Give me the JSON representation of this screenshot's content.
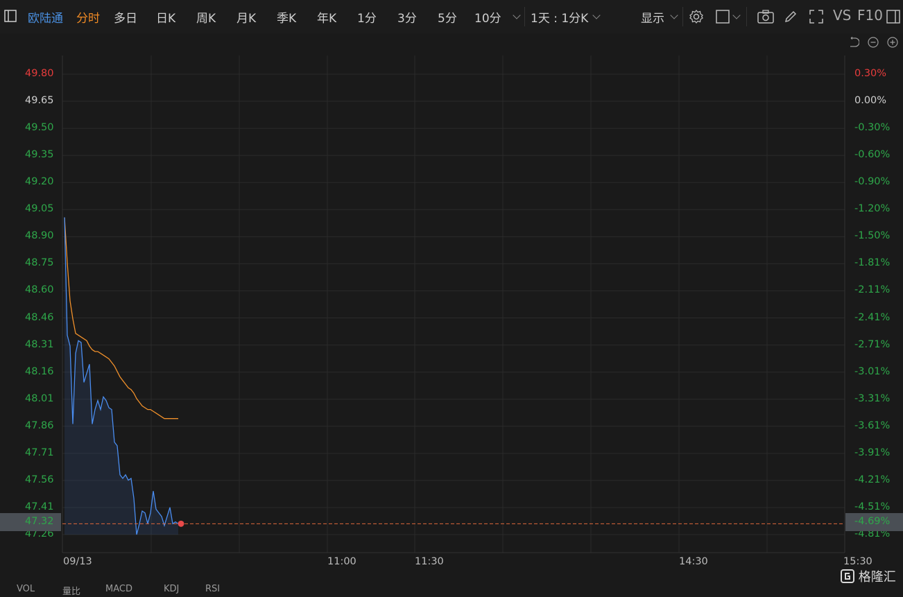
{
  "toolbar": {
    "stock_name": "欧陆通",
    "tabs": [
      "分时",
      "多日",
      "日K",
      "周K",
      "月K",
      "季K",
      "年K",
      "1分",
      "3分",
      "5分",
      "10分"
    ],
    "active_tab": "分时",
    "interval_select": "1天 : 1分K",
    "display_label": "显示",
    "vs_label": "VS",
    "f10_label": "F10"
  },
  "chart_data": {
    "type": "line",
    "date_label": "09/13",
    "time_ticks": [
      "11:00",
      "11:30",
      "14:30",
      "15:30"
    ],
    "price_ticks": [
      "49.80",
      "49.65",
      "49.50",
      "49.35",
      "49.20",
      "49.05",
      "48.90",
      "48.75",
      "48.60",
      "48.46",
      "48.31",
      "48.16",
      "48.01",
      "47.86",
      "47.71",
      "47.56",
      "47.41",
      "47.26"
    ],
    "pct_ticks": [
      "0.30%",
      "0.00%",
      "-0.30%",
      "-0.60%",
      "-0.90%",
      "-1.20%",
      "-1.50%",
      "-1.81%",
      "-2.11%",
      "-2.41%",
      "-2.71%",
      "-3.01%",
      "-3.31%",
      "-3.61%",
      "-3.91%",
      "-4.21%",
      "-4.51%",
      "-4.81%"
    ],
    "ylim": [
      47.26,
      49.8
    ],
    "prev_close": 49.65,
    "current_price": "47.32",
    "current_pct": "-4.69%",
    "price_series": {
      "name": "price",
      "x": [
        0,
        1,
        2,
        3,
        4,
        5,
        6,
        7,
        8,
        9,
        10,
        11,
        12,
        13,
        14,
        15,
        16,
        17,
        18,
        19,
        20,
        21,
        22,
        23,
        24,
        25,
        26,
        27,
        28,
        29,
        30,
        31,
        32,
        33,
        34,
        35,
        36,
        37,
        38,
        39,
        40,
        41,
        42,
        43,
        44,
        45,
        46,
        47
      ],
      "values": [
        49.01,
        48.36,
        48.3,
        47.87,
        48.26,
        48.33,
        48.32,
        48.1,
        48.15,
        48.2,
        47.87,
        47.95,
        48.0,
        47.95,
        48.02,
        48.0,
        47.96,
        47.95,
        47.77,
        47.75,
        47.59,
        47.57,
        47.59,
        47.56,
        47.57,
        47.46,
        47.26,
        47.32,
        47.39,
        47.38,
        47.32,
        47.38,
        47.5,
        47.4,
        47.38,
        47.36,
        47.31,
        47.36,
        47.41,
        47.32,
        47.33,
        47.32,
        null,
        null,
        null,
        null,
        null,
        null
      ]
    },
    "avg_series": {
      "name": "avg",
      "x": [
        0,
        1,
        2,
        3,
        4,
        5,
        6,
        7,
        8,
        9,
        10,
        11,
        12,
        13,
        14,
        15,
        16,
        17,
        18,
        19,
        20,
        21,
        22,
        23,
        24,
        25,
        26,
        27,
        28,
        29,
        30,
        31,
        32,
        33,
        34,
        35,
        36,
        37,
        38,
        39,
        40,
        41,
        42,
        43,
        44,
        45,
        46,
        47
      ],
      "values": [
        49.01,
        48.76,
        48.55,
        48.45,
        48.37,
        48.36,
        48.35,
        48.34,
        48.33,
        48.3,
        48.28,
        48.27,
        48.27,
        48.26,
        48.25,
        48.24,
        48.23,
        48.21,
        48.19,
        48.16,
        48.13,
        48.11,
        48.09,
        48.07,
        48.06,
        48.04,
        48.01,
        47.99,
        47.97,
        47.96,
        47.95,
        47.95,
        47.94,
        47.93,
        47.92,
        47.91,
        47.9,
        47.9,
        47.9,
        47.9,
        47.9,
        47.9,
        null,
        null,
        null,
        null,
        null,
        null
      ]
    },
    "bottom_tabs": [
      "VOL",
      "量比",
      "MACD",
      "KDJ",
      "RSI"
    ],
    "colors": {
      "price_line": "#4a8df0",
      "avg_line": "#f0902b",
      "up": "#e83c3c",
      "down": "#2ea84a",
      "neutral": "#d0d0d0",
      "current_dash": "#e0683a"
    }
  },
  "watermark": "格隆汇"
}
